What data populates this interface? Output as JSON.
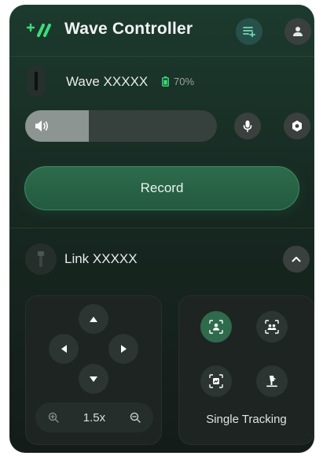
{
  "app": {
    "title": "Wave Controller",
    "accent": "#3ddc7a"
  },
  "header": {
    "playlist_icon": "playlist-add-icon",
    "user_icon": "user-icon"
  },
  "device": {
    "name": "Wave XXXXX",
    "battery_label": "70%",
    "icon": "microphone-device-icon"
  },
  "audio": {
    "volume_level": 0.33,
    "volume_icon": "speaker-icon",
    "mic_icon": "mic-icon",
    "settings_icon": "hexagon-settings-icon"
  },
  "record": {
    "label": "Record"
  },
  "link": {
    "name": "Link XXXXX",
    "icon": "gimbal-icon",
    "collapse_icon": "chevron-up-icon"
  },
  "control": {
    "zoom_value": "1.5x",
    "zoom_in_icon": "zoom-in-icon",
    "zoom_out_icon": "zoom-out-icon"
  },
  "tracking": {
    "mode_label": "Single Tracking",
    "modes": [
      "single-person-tracking-icon",
      "group-tracking-icon",
      "object-tracking-icon",
      "desk-tracking-icon"
    ]
  }
}
